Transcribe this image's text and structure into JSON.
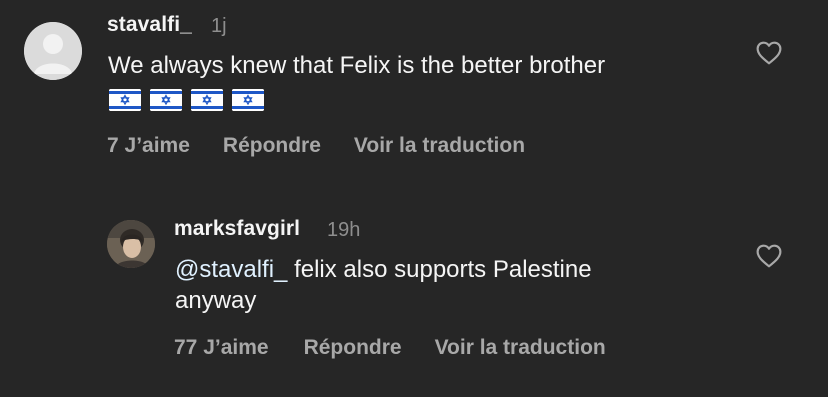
{
  "comments": [
    {
      "username": "stavalfi_",
      "time": "1j",
      "text": "We always knew that Felix is the better brother",
      "flags": [
        "flag-israel",
        "flag-israel",
        "flag-israel",
        "flag-israel"
      ],
      "actions": {
        "likes": "7 J’aime",
        "reply": "Répondre",
        "translate": "Voir la traduction"
      },
      "icons": {
        "avatar": "default-avatar-icon",
        "like": "heart-outline-icon"
      }
    },
    {
      "username": "marksfavgirl",
      "time": "19h",
      "mention": "@stavalfi_",
      "text_line1": " felix also supports Palestine",
      "text_line2": "anyway",
      "actions": {
        "likes": "77 J’aime",
        "reply": "Répondre",
        "translate": "Voir la traduction"
      },
      "icons": {
        "avatar": "profile-photo",
        "like": "heart-outline-icon"
      }
    }
  ],
  "colors": {
    "background": "#262626",
    "primary_text": "#f5f5f5",
    "secondary_text": "#8e8e8e",
    "action_text": "#a8a8a8",
    "flag_blue": "#1e57c6"
  }
}
